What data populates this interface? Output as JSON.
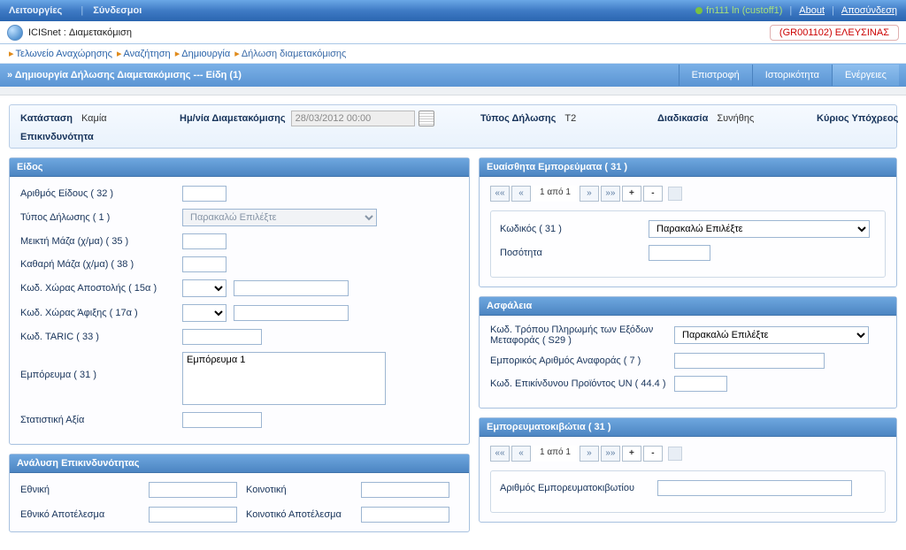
{
  "topbar": {
    "nav": [
      "Λειτουργίες",
      "Σύνδεσμοι"
    ],
    "user": "fn111 ln (custoff1)",
    "about": "About",
    "logout": "Αποσύνδεση"
  },
  "title": {
    "app": "ICISnet : Διαμετακόμιση",
    "location": "(GR001102) ΕΛΕΥΣΙΝΑΣ"
  },
  "breadcrumb": [
    "Τελωνείο Αναχώρησης",
    "Αναζήτηση",
    "Δημιουργία",
    "Δήλωση διαμετακόμισης"
  ],
  "pagebar": {
    "title": "» Δημιουργία Δήλωσης Διαμετακόμισης --- Είδη (1)",
    "actions": [
      "Επιστροφή",
      "Ιστορικότητα",
      "Ενέργειες"
    ]
  },
  "info": {
    "status_label": "Κατάσταση",
    "status_value": "Καμία",
    "date_label": "Ημ/νία Διαμετακόμισης",
    "date_value": "28/03/2012 00:00",
    "type_label": "Τύπος Δήλωσης",
    "type_value": "T2",
    "procedure_label": "Διαδικασία",
    "procedure_value": "Συνήθης",
    "principal_label": "Κύριος Υπόχρεος",
    "risk_label": "Επικινδυνότητα"
  },
  "species": {
    "title": "Είδος",
    "item_no": "Αριθμός Είδους ( 32 )",
    "decl_type": "Τύπος Δήλωσης ( 1 )",
    "decl_type_placeholder": "Παρακαλώ Επιλέξτε",
    "gross": "Μεικτή Μάζα (χ/μα) ( 35 )",
    "net": "Καθαρή Μάζα (χ/μα) ( 38 )",
    "dispatch": "Κωδ. Χώρας Αποστολής ( 15α )",
    "arrival": "Κωδ. Χώρας Άφιξης ( 17α )",
    "taric": "Κωδ. TARIC ( 33 )",
    "goods": "Εμπόρευμα ( 31 )",
    "goods_value": "Εμπόρευμα 1",
    "stat": "Στατιστική Αξία"
  },
  "risk": {
    "title": "Ανάλυση Επικινδυνότητας",
    "national": "Εθνική",
    "community": "Κοινοτική",
    "national_result": "Εθνικό Αποτέλεσμα",
    "community_result": "Κοινοτικό Αποτέλεσμα"
  },
  "sensitive": {
    "title": "Ευαίσθητα Εμπορεύματα ( 31 )",
    "pager_text": "1 από 1",
    "code_label": "Κωδικός ( 31 )",
    "code_placeholder": "Παρακαλώ Επιλέξτε",
    "qty_label": "Ποσότητα"
  },
  "safety": {
    "title": "Ασφάλεια",
    "payment": "Κωδ. Τρόπου Πληρωμής των Εξόδων Μεταφοράς ( S29 )",
    "payment_placeholder": "Παρακαλώ Επιλέξτε",
    "ref": "Εμπορικός Αριθμός Αναφοράς ( 7 )",
    "un": "Κωδ. Επικίνδυνου Προϊόντος UN ( 44.4 )"
  },
  "containers": {
    "title": "Εμπορευματοκιβώτια ( 31 )",
    "pager_text": "1 από 1",
    "number": "Αριθμός Εμπορευματοκιβωτίου"
  }
}
